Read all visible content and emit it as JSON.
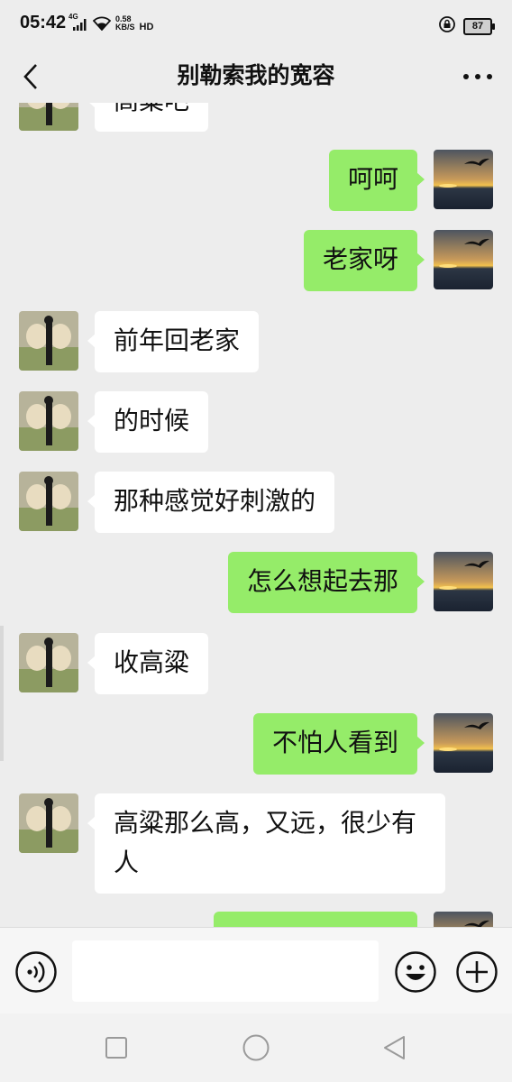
{
  "status_bar": {
    "time": "05:42",
    "network": "4G",
    "speed_value": "0.58",
    "speed_unit": "KB/S",
    "hd_label": "HD",
    "battery": "87"
  },
  "header": {
    "title": "别勒索我的宽容",
    "back_icon": "chevron-left-icon",
    "more_icon": "ellipsis-icon"
  },
  "messages": [
    {
      "side": "recv",
      "text": "高粱吧"
    },
    {
      "side": "sent",
      "text": "呵呵"
    },
    {
      "side": "sent",
      "text": "老家呀"
    },
    {
      "side": "recv",
      "text": "前年回老家"
    },
    {
      "side": "recv",
      "text": "的时候"
    },
    {
      "side": "recv",
      "text": "那种感觉好刺激的"
    },
    {
      "side": "sent",
      "text": "怎么想起去那"
    },
    {
      "side": "recv",
      "text": "收高粱"
    },
    {
      "side": "sent",
      "text": "不怕人看到"
    },
    {
      "side": "recv",
      "text": "高粱那么高，又远，很少有人"
    },
    {
      "side": "sent",
      "text": ""
    }
  ],
  "input_bar": {
    "voice_icon": "voice-icon",
    "message_value": "",
    "emoji_icon": "emoji-icon",
    "plus_icon": "plus-icon"
  },
  "nav_bar": {
    "square_icon": "recent-apps-icon",
    "circle_icon": "home-icon",
    "triangle_icon": "back-icon"
  },
  "colors": {
    "background": "#ededed",
    "sent_bubble": "#95ec69",
    "recv_bubble": "#ffffff"
  }
}
